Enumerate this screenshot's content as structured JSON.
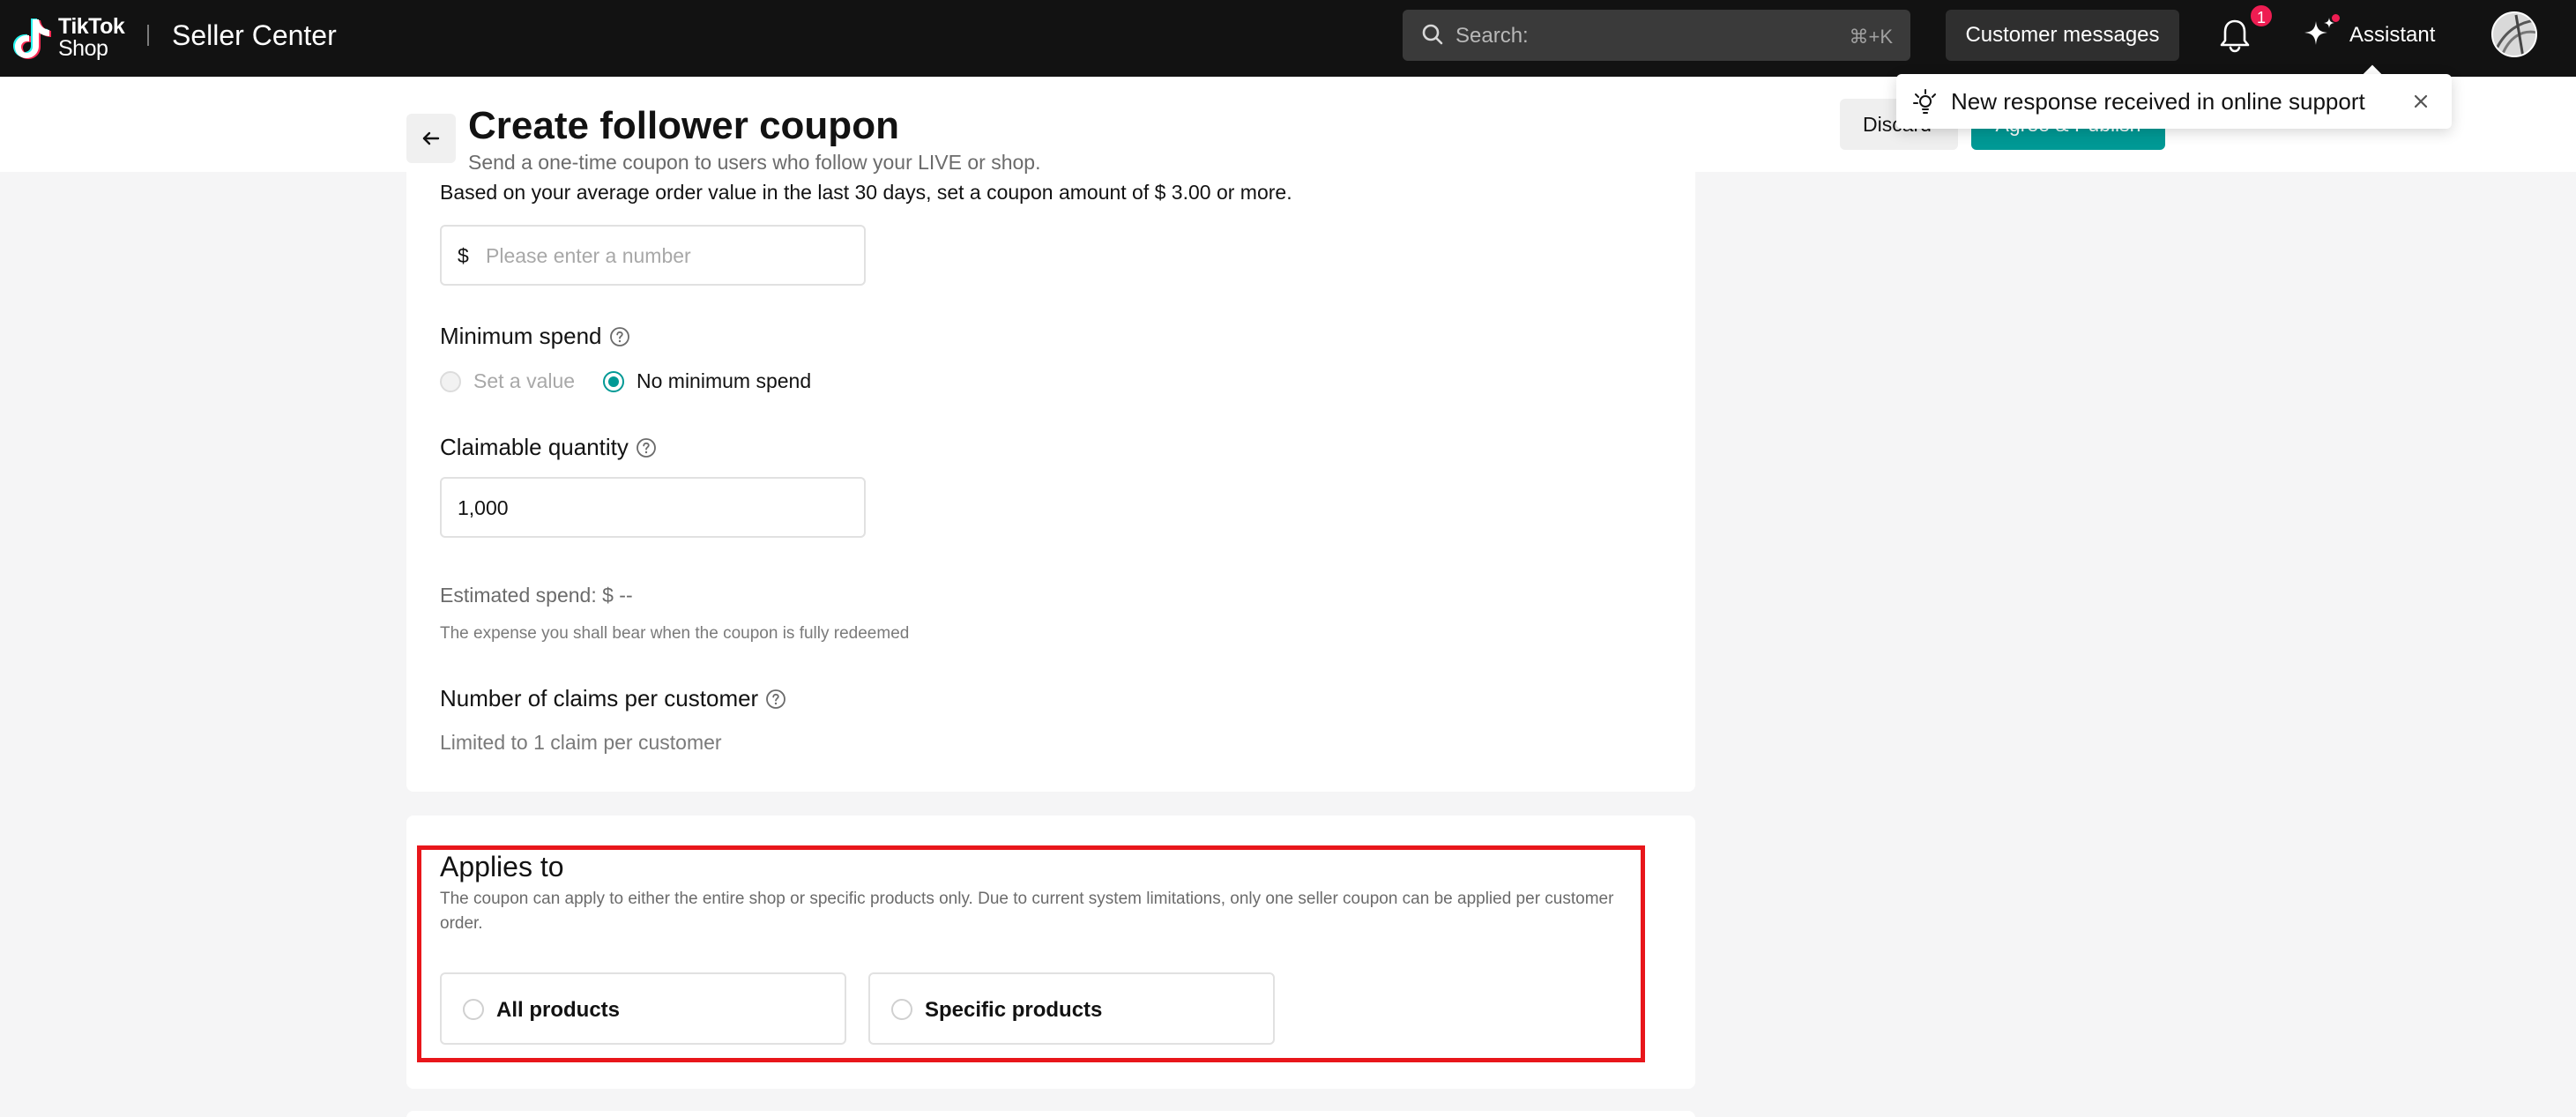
{
  "topbar": {
    "logo_line1": "TikTok",
    "logo_line2": "Shop",
    "app_name": "Seller Center",
    "search_placeholder": "Search:",
    "search_shortcut": "⌘+K",
    "customer_messages_label": "Customer messages",
    "notification_count": "1",
    "assistant_label": "Assistant"
  },
  "header": {
    "title": "Create follower coupon",
    "subtitle": "Send a one-time coupon to users who follow your LIVE or shop.",
    "discard_label": "Discard",
    "publish_label": "Agree & Publish"
  },
  "toast": {
    "message": "New response received in online support"
  },
  "coupon_amount": {
    "hint": "Based on your average order value in the last 30 days, set a coupon amount of $ 3.00 or more.",
    "currency_prefix": "$",
    "placeholder": "Please enter a number"
  },
  "minimum_spend": {
    "label": "Minimum spend",
    "options": [
      {
        "label": "Set a value",
        "selected": false,
        "disabled": true
      },
      {
        "label": "No minimum spend",
        "selected": true,
        "disabled": false
      }
    ]
  },
  "claimable_quantity": {
    "label": "Claimable quantity",
    "value": "1,000"
  },
  "estimated_spend": {
    "label": "Estimated spend: $ --",
    "note": "The expense you shall bear when the coupon is fully redeemed"
  },
  "claims_per_customer": {
    "label": "Number of claims per customer",
    "value": "Limited to 1 claim per customer"
  },
  "applies_to": {
    "title": "Applies to",
    "description": "The coupon can apply to either the entire shop or specific products only. Due to current system limitations, only one seller coupon can be applied per customer order.",
    "options": [
      {
        "label": "All products",
        "selected": false
      },
      {
        "label": "Specific products",
        "selected": false
      }
    ]
  },
  "colors": {
    "accent": "#009995",
    "highlight": "#e8161b",
    "badge": "#ee1d52",
    "topbar_bg": "#121212"
  },
  "icons": [
    "tiktok-logo-icon",
    "search-icon",
    "bell-icon",
    "sparkle-icon",
    "avatar",
    "back-arrow-icon",
    "help-circle-icon",
    "support-bulb-icon",
    "close-icon"
  ]
}
